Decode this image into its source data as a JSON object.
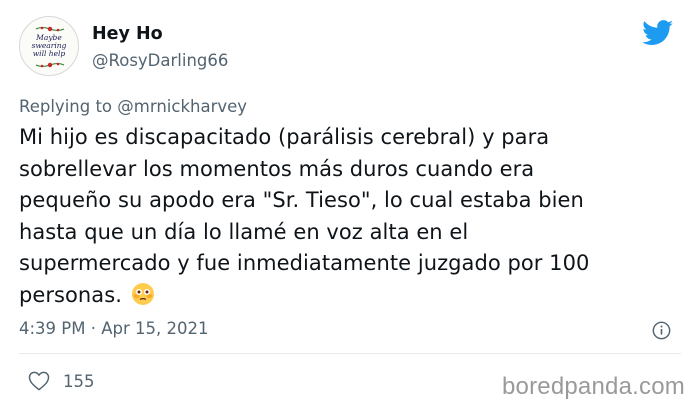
{
  "tweet": {
    "avatar": {
      "lines": [
        "Maybe",
        "swearing",
        "will help"
      ]
    },
    "display_name": "Hey Ho",
    "handle": "@RosyDarling66",
    "reply_prefix": "Replying to ",
    "reply_mention": "@mrnickharvey",
    "body_lines": [
      "Mi hijo es discapacitado (parálisis cerebral) y para",
      "sobrellevar los momentos más duros cuando era",
      "pequeño su apodo era \"Sr. Tieso\", lo cual estaba bien",
      "hasta que un día lo llamé en voz alta en el",
      "supermercado y fue inmediatamente juzgado por 100",
      "personas."
    ],
    "emoji": "flushed-face",
    "timestamp": "4:39 PM · Apr 15, 2021",
    "likes_count": "155"
  },
  "icons": {
    "brand": "twitter-bird-icon",
    "info": "info-icon",
    "like": "heart-icon"
  },
  "colors": {
    "twitter_blue": "#1d9bf0",
    "muted_text": "#536471",
    "primary_text": "#0f1419",
    "watermark": "#9a9a9a"
  },
  "watermark": "boredpanda.com"
}
